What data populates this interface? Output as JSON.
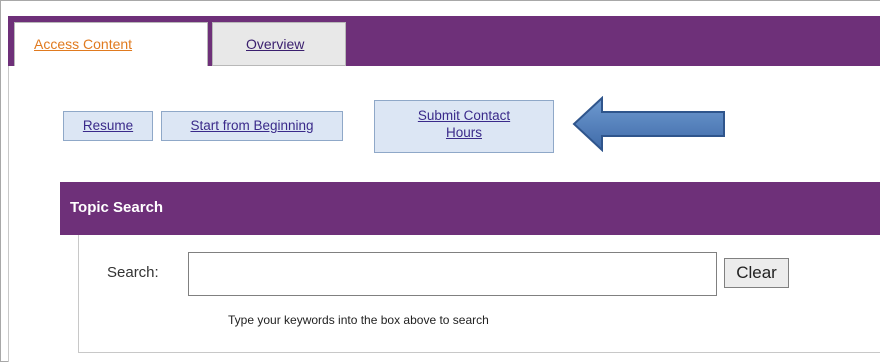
{
  "tabs": [
    {
      "label": "Access Content",
      "active": true
    },
    {
      "label": "Overview",
      "active": false
    }
  ],
  "actions": {
    "resume_label": "Resume",
    "start_label": "Start from Beginning",
    "submit_label_line1": "Submit Contact",
    "submit_label_line2": "Hours"
  },
  "topic_search": {
    "title": "Topic Search",
    "search_label": "Search:",
    "search_value": "",
    "clear_label": "Clear",
    "hint": "Type your keywords into the box above to search"
  },
  "colors": {
    "brand_purple": "#6e3079",
    "active_tab_text": "#e07a1f",
    "button_bg": "#dce6f4",
    "arrow_fill": "#4a7ab8"
  },
  "annotation": {
    "icon": "left-arrow-icon"
  }
}
